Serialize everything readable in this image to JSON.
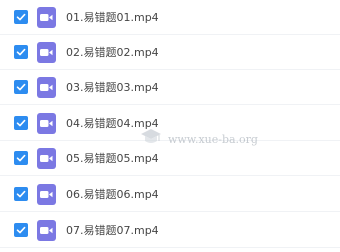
{
  "files": [
    {
      "name": "01.易错题01.mp4",
      "checked": true,
      "icon": "video-file-icon"
    },
    {
      "name": "02.易错题02.mp4",
      "checked": true,
      "icon": "video-file-icon"
    },
    {
      "name": "03.易错题03.mp4",
      "checked": true,
      "icon": "video-file-icon"
    },
    {
      "name": "04.易错题04.mp4",
      "checked": true,
      "icon": "video-file-icon"
    },
    {
      "name": "05.易错题05.mp4",
      "checked": true,
      "icon": "video-file-icon"
    },
    {
      "name": "06.易错题06.mp4",
      "checked": true,
      "icon": "video-file-icon"
    },
    {
      "name": "07.易错题07.mp4",
      "checked": true,
      "icon": "video-file-icon"
    }
  ],
  "watermark": {
    "text": "www.xue-ba.org"
  },
  "colors": {
    "checkbox": "#2d8cf0",
    "file_icon": "#7b78e3",
    "text": "#454545"
  }
}
